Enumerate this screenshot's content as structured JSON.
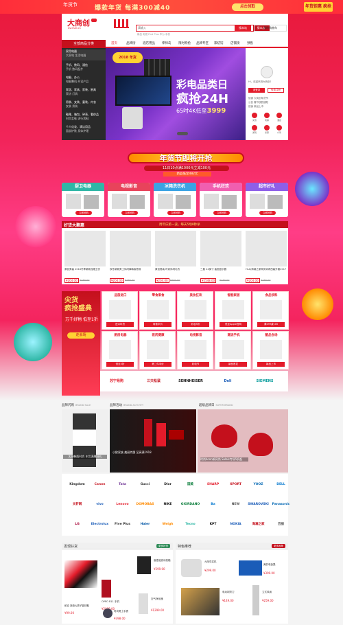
{
  "topbar": {
    "new_year_label": "年货节",
    "promo": "爆款年货 每满300减40",
    "cta": "点击领取",
    "tag": "年货钜惠 疯抢"
  },
  "header": {
    "logo": "大商创",
    "logo_sub": "dscmall.cn",
    "search_placeholder": "请输入",
    "search_btn": "搜本站",
    "search_btn2": "搜本店",
    "hotwords": "新品 电视 Find Plus 华为 手机",
    "cart": "我的购物车"
  },
  "nav": {
    "all": "全部商品分类",
    "items": [
      "首页",
      "品牌街",
      "酒店用品",
      "拳师岛",
      "限时购抢",
      "品牌专区",
      "家纺馆",
      "店铺街",
      "预售"
    ]
  },
  "categories": [
    {
      "title": "家用电器",
      "sub": "大家电 生活电器"
    },
    {
      "title": "手机、数码、通信",
      "sub": "手机 数码配件"
    },
    {
      "title": "电脑、办公",
      "sub": "电脑整机 外设产品"
    },
    {
      "title": "家居、家具、家装、厨具",
      "sub": "家纺 灯具"
    },
    {
      "title": "男装、女装、童装、内衣",
      "sub": "女装 男装"
    },
    {
      "title": "鞋靴、箱包、钟表、奢侈品",
      "sub": "时尚女鞋 流行男鞋"
    },
    {
      "title": "个人化妆、清洁用品",
      "sub": "面部护肤 身体护理"
    }
  ],
  "banner": {
    "year": "2018 年货",
    "title": "彩电品类日",
    "big": "疯抢24H",
    "line": "65吋4K低至",
    "price": "3999"
  },
  "userbox": {
    "greeting": "Hi，欢迎来到大商创！",
    "login": "请登录",
    "register": "免费注册",
    "news": [
      "促销 大商创年货节",
      "公告 春节放假通知",
      "促销 新品上市"
    ],
    "services": [
      "充值",
      "机票",
      "酒店",
      "游戏",
      "彩票",
      "众筹"
    ]
  },
  "title_banner": {
    "main": "年货节即将开抢",
    "sub": "11日10点满1000元立减100元",
    "sub2": "新品低至482元"
  },
  "cat_cards": [
    {
      "title": "厨卫电器",
      "go": "立即抢购",
      "color": "#2fb7a6"
    },
    {
      "title": "电视影音",
      "go": "立即抢购",
      "color": "#e8435b"
    },
    {
      "title": "冰箱洗衣机",
      "go": "立即抢购",
      "color": "#3aa3e3"
    },
    {
      "title": "手机狂欢",
      "go": "立即抢购",
      "color": "#f05fb0"
    },
    {
      "title": "超市好礼",
      "go": "立即抢购",
      "color": "#8e5fe8"
    }
  ],
  "goods_section": {
    "title": "好货大聚惠",
    "slogan": "周年庆第一波，每天5场8秒杀"
  },
  "goods": [
    {
      "name": "原创男装 2018冬季新款连帽卫衣",
      "price": "¥204.00",
      "old": "¥260.00"
    },
    {
      "name": "秋冬新款男士休闲裤韩版修身",
      "price": "¥204.00",
      "old": "¥260.00"
    },
    {
      "name": "原创男装 时尚休闲毛衣",
      "price": "¥204.00",
      "old": "¥260.00"
    },
    {
      "name": "三星 24英寸 曲面显示器",
      "price": "¥2548.00",
      "old": "¥260.00"
    },
    {
      "name": "HLA/海澜之家商务休闲西装外套2017",
      "price": "¥204.00",
      "old": "¥260.00"
    }
  ],
  "flash": {
    "a": "尖货",
    "b": "疯抢盛典",
    "c": "万千好物 低至1折",
    "go": "走会场"
  },
  "flash_cells": [
    {
      "h": "品质进口",
      "tag": "进口年货"
    },
    {
      "h": "零食果食",
      "tag": "零食半价"
    },
    {
      "h": "美妆狂欢",
      "tag": "彩妆5折"
    },
    {
      "h": "智能家居",
      "tag": "低至Apple官网"
    },
    {
      "h": "食品饮料",
      "tag": "满199减100"
    },
    {
      "h": "厨房电器",
      "tag": "低至3折"
    },
    {
      "h": "医药健康",
      "tag": "第二件半价"
    },
    {
      "h": "电视影音",
      "tag": "彩电节"
    },
    {
      "h": "潮流手机",
      "tag": "新品首发"
    },
    {
      "h": "酷品会场",
      "tag": "新品上市"
    }
  ],
  "brand_strip": [
    "苏宁易购",
    "三只松鼠",
    "SENNHEISER",
    "Deli",
    "SIEMENS"
  ],
  "sections": {
    "brand_sale": "品牌闪购",
    "brand_sale_en": "BRAND SALE",
    "activity": "品牌活动",
    "activity_en": "BRAND ACTIVITY",
    "super": "超级品牌日",
    "super_en": "SUPER BRAND"
  },
  "panels": {
    "p1": "太妹韩版时尚 年货满赠好礼",
    "p2": "小欧家族 美丽特惠 至高满1918",
    "p3": "时尚bcon新风尚 Salais专场5折起"
  },
  "logos": [
    "Kingdom",
    "Canon",
    "Tata",
    "Gucci",
    "Dior",
    "国美",
    "SHARP",
    "XPORT",
    "YOOZ",
    "DELL",
    "文轩网",
    "vivo",
    "Lenovo",
    "DOMOBAS",
    "NIKE",
    "GIORDANO",
    "Ba",
    "NEW",
    "SWAROVSKI",
    "Panasonic",
    "LG",
    "Electrolux",
    "Five Plus",
    "Haier",
    "Weigh",
    "Tecno",
    "KPT",
    "NOKIA",
    "海澜之家",
    "百丽"
  ],
  "bottom": {
    "left_title": "发现好货",
    "right_title": "特色推荐",
    "more": "更多好货",
    "more2": "更多推荐",
    "left_items": [
      {
        "name": "耐克 新款AJ男子篮球鞋",
        "price": "¥99.00"
      },
      {
        "name": "OPPO R11 手机",
        "price": "¥2999.00"
      },
      {
        "name": "高性能游戏机箱",
        "price": "¥599.00"
      },
      {
        "name": "时尚男士手表",
        "price": "¥398.00"
      },
      {
        "name": "空气净化器",
        "price": "¥1299.00"
      }
    ],
    "right_items": [
      {
        "name": "九阳豆浆机",
        "price": "¥299.00"
      },
      {
        "name": "美的电饭煲",
        "price": "¥399.00"
      },
      {
        "name": "电动剃须刀",
        "price": "¥149.00"
      },
      {
        "name": "立式风扇",
        "price": "¥259.00"
      }
    ]
  }
}
